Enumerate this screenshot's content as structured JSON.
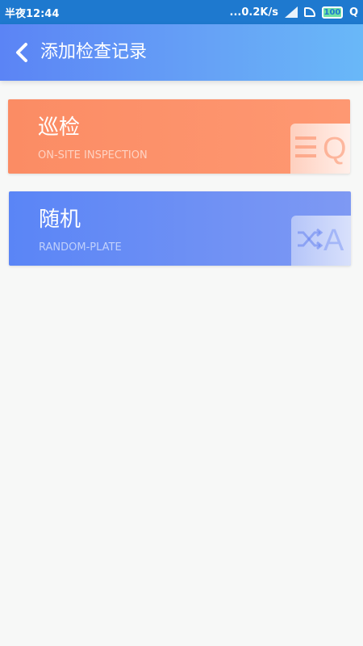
{
  "status_bar": {
    "time": "半夜12:44",
    "network_speed": "...0.2K/s",
    "battery": "100",
    "search": "Q",
    "icons": [
      "signal-icon",
      "wifi-icon",
      "battery-icon",
      "search-icon"
    ]
  },
  "header": {
    "back_icon": "chevron-left-icon",
    "title": "添加检查记录"
  },
  "cards": [
    {
      "title": "巡检",
      "subtitle": "ON-SITE INSPECTION",
      "badge_letter": "Q",
      "icon": "list-icon",
      "color_start": "#fb8c64",
      "color_end": "#fe9872"
    },
    {
      "title": "随机",
      "subtitle": "RANDOM-PLATE",
      "badge_letter": "A",
      "icon": "shuffle-icon",
      "color_start": "#5a85f6",
      "color_end": "#7e99f3"
    }
  ],
  "colors": {
    "status_bar": "#1e79cf",
    "header_start": "#5b84f5",
    "header_end": "#69b8f8",
    "background": "#f7f8f7"
  }
}
